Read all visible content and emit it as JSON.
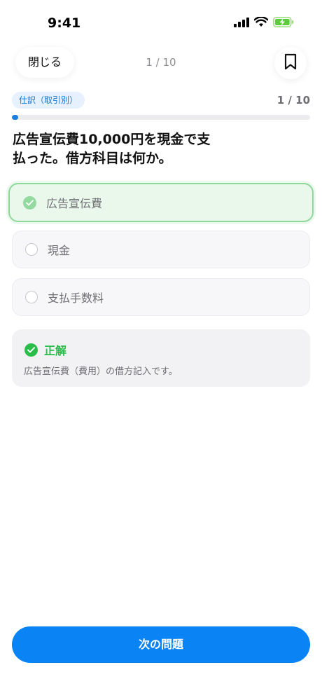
{
  "status_bar": {
    "time": "9:41",
    "icons": [
      "signal-icon",
      "wifi-icon",
      "battery-charging-icon"
    ]
  },
  "nav": {
    "close_label": "閉じる",
    "counter": "1 / 10",
    "bookmark_icon": "bookmark-icon"
  },
  "progress": {
    "category": "仕訳（取引別）",
    "count": "1 / 10",
    "fraction": 0.02
  },
  "question": {
    "text": "広告宣伝費10,000円を現金で支払った。借方科目は何か。"
  },
  "options": [
    {
      "label": "広告宣伝費",
      "state": "correct"
    },
    {
      "label": "現金",
      "state": "default"
    },
    {
      "label": "支払手数料",
      "state": "default"
    }
  ],
  "result": {
    "title": "正解",
    "detail": "広告宣伝費（費用）の借方記入です。"
  },
  "next_button": {
    "label": "次の問題"
  },
  "colors": {
    "accent": "#0a84f5",
    "correct_green": "#2bbd4a",
    "correct_bg": "#eaf8ec",
    "correct_border": "#8fd89c",
    "badge_bg": "#e6f1fd",
    "badge_text": "#1677d2"
  }
}
